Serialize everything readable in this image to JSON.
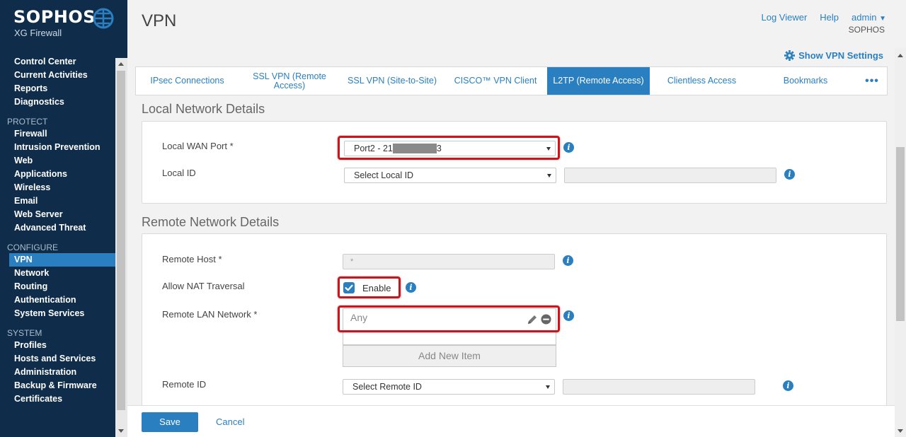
{
  "brand": {
    "name": "SOPHOS",
    "product": "XG Firewall"
  },
  "sidebar": {
    "sections": [
      {
        "title": "",
        "items": [
          "Control Center",
          "Current Activities",
          "Reports",
          "Diagnostics"
        ]
      },
      {
        "title": "PROTECT",
        "items": [
          "Firewall",
          "Intrusion Prevention",
          "Web",
          "Applications",
          "Wireless",
          "Email",
          "Web Server",
          "Advanced Threat"
        ]
      },
      {
        "title": "CONFIGURE",
        "items": [
          "VPN",
          "Network",
          "Routing",
          "Authentication",
          "System Services"
        ]
      },
      {
        "title": "SYSTEM",
        "items": [
          "Profiles",
          "Hosts and Services",
          "Administration",
          "Backup & Firmware",
          "Certificates"
        ]
      }
    ],
    "active_item": "VPN"
  },
  "header": {
    "title": "VPN",
    "log_viewer": "Log Viewer",
    "help": "Help",
    "admin": "admin",
    "org": "SOPHOS",
    "show_settings": "Show VPN Settings"
  },
  "tabs": [
    {
      "label": "IPsec Connections"
    },
    {
      "label": "SSL VPN (Remote Access)"
    },
    {
      "label": "SSL VPN (Site-to-Site)"
    },
    {
      "label": "CISCO™ VPN Client"
    },
    {
      "label": "L2TP (Remote Access)"
    },
    {
      "label": "Clientless Access"
    },
    {
      "label": "Bookmarks"
    },
    {
      "label": "•••"
    }
  ],
  "active_tab": "L2TP (Remote Access)",
  "local": {
    "section_title": "Local Network Details",
    "wan_port_label": "Local WAN Port *",
    "wan_port_value_start": "Port2 - 21",
    "wan_port_value_end": "3",
    "local_id_label": "Local ID",
    "local_id_value": "Select Local ID"
  },
  "remote": {
    "section_title": "Remote Network Details",
    "host_label": "Remote Host *",
    "host_value": "*",
    "nat_label": "Allow NAT Traversal",
    "nat_checkbox_label": "Enable",
    "nat_checked": true,
    "lan_label": "Remote LAN Network *",
    "lan_items": [
      "Any"
    ],
    "add_item": "Add New Item",
    "remote_id_label": "Remote ID",
    "remote_id_value": "Select Remote ID"
  },
  "actions": {
    "save": "Save",
    "cancel": "Cancel"
  },
  "colors": {
    "sidebar_bg": "#0f2d4a",
    "accent": "#2a7fc1",
    "highlight": "#c8161e"
  }
}
